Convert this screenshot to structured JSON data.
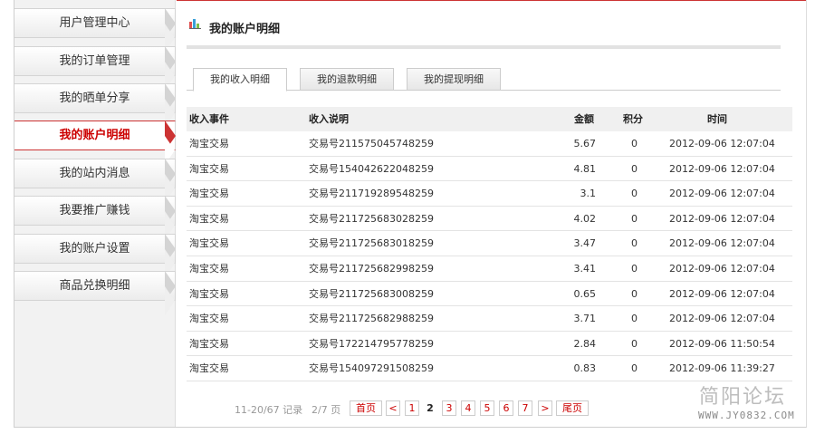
{
  "sidebar": {
    "items": [
      {
        "label": "用户管理中心"
      },
      {
        "label": "我的订单管理"
      },
      {
        "label": "我的晒单分享"
      },
      {
        "label": "我的账户明细"
      },
      {
        "label": "我的站内消息"
      },
      {
        "label": "我要推广赚钱"
      },
      {
        "label": "我的账户设置"
      },
      {
        "label": "商品兑换明细"
      }
    ],
    "active_index": 3
  },
  "header": {
    "title": "我的账户明细",
    "icon": "bar-chart-icon"
  },
  "tabs": [
    {
      "label": "我的收入明细",
      "active": true
    },
    {
      "label": "我的退款明细",
      "active": false
    },
    {
      "label": "我的提现明细",
      "active": false
    }
  ],
  "table": {
    "columns": [
      "收入事件",
      "收入说明",
      "金额",
      "积分",
      "时间"
    ],
    "rows": [
      {
        "event": "淘宝交易",
        "desc": "交易号211575045748259",
        "amount": "5.67",
        "points": "0",
        "time": "2012-09-06 12:07:04"
      },
      {
        "event": "淘宝交易",
        "desc": "交易号154042622048259",
        "amount": "4.81",
        "points": "0",
        "time": "2012-09-06 12:07:04"
      },
      {
        "event": "淘宝交易",
        "desc": "交易号211719289548259",
        "amount": "3.1",
        "points": "0",
        "time": "2012-09-06 12:07:04"
      },
      {
        "event": "淘宝交易",
        "desc": "交易号211725683028259",
        "amount": "4.02",
        "points": "0",
        "time": "2012-09-06 12:07:04"
      },
      {
        "event": "淘宝交易",
        "desc": "交易号211725683018259",
        "amount": "3.47",
        "points": "0",
        "time": "2012-09-06 12:07:04"
      },
      {
        "event": "淘宝交易",
        "desc": "交易号211725682998259",
        "amount": "3.41",
        "points": "0",
        "time": "2012-09-06 12:07:04"
      },
      {
        "event": "淘宝交易",
        "desc": "交易号211725683008259",
        "amount": "0.65",
        "points": "0",
        "time": "2012-09-06 12:07:04"
      },
      {
        "event": "淘宝交易",
        "desc": "交易号211725682988259",
        "amount": "3.71",
        "points": "0",
        "time": "2012-09-06 12:07:04"
      },
      {
        "event": "淘宝交易",
        "desc": "交易号172214795778259",
        "amount": "2.84",
        "points": "0",
        "time": "2012-09-06 11:50:54"
      },
      {
        "event": "淘宝交易",
        "desc": "交易号154097291508259",
        "amount": "0.83",
        "points": "0",
        "time": "2012-09-06 11:39:27"
      }
    ]
  },
  "pagination": {
    "records": "11-20/67 记录",
    "pages": "2/7 页",
    "first": "首页",
    "prev": "<",
    "numbers": [
      "1",
      "2",
      "3",
      "4",
      "5",
      "6",
      "7"
    ],
    "current": "2",
    "next": ">",
    "last": "尾页"
  },
  "watermark": {
    "text": "简阳论坛",
    "url": "WWW.JY0832.COM"
  },
  "colors": {
    "accent": "#cc0000",
    "active_border": "#cc3333"
  }
}
